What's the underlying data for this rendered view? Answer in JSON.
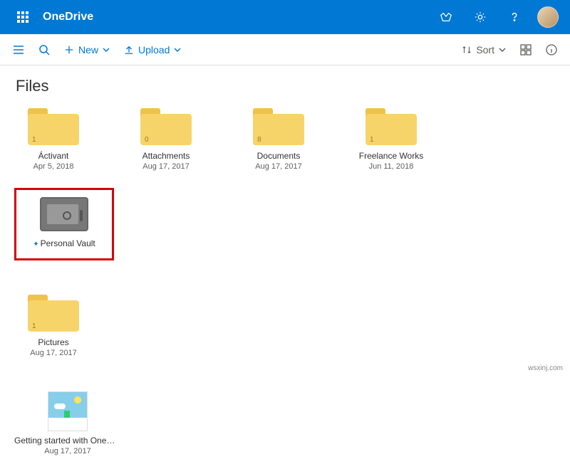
{
  "header": {
    "brand": "OneDrive"
  },
  "cmd": {
    "new_label": "New",
    "upload_label": "Upload",
    "sort_label": "Sort"
  },
  "page": {
    "title": "Files"
  },
  "items": [
    {
      "type": "folder",
      "name": "Áctivant",
      "date": "Apr 5, 2018",
      "count": "1"
    },
    {
      "type": "folder",
      "name": "Attachments",
      "date": "Aug 17, 2017",
      "count": "0"
    },
    {
      "type": "folder",
      "name": "Documents",
      "date": "Aug 17, 2017",
      "count": "8"
    },
    {
      "type": "folder",
      "name": "Freelance Works",
      "date": "Jun 11, 2018",
      "count": "1"
    },
    {
      "type": "vault",
      "name": "Personal Vault"
    },
    {
      "type": "folder",
      "name": "Pictures",
      "date": "Aug 17, 2017",
      "count": "1"
    },
    {
      "type": "file",
      "name": "Getting started with OneD…",
      "date": "Aug 17, 2017"
    }
  ],
  "watermark": "wsxinj.com"
}
